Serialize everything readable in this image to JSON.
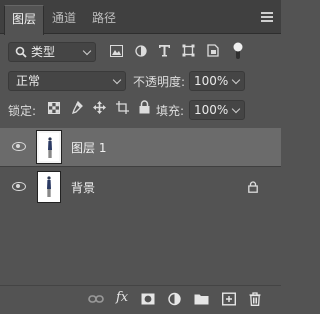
{
  "tabs": [
    {
      "label": "图层",
      "active": true
    },
    {
      "label": "通道",
      "active": false
    },
    {
      "label": "路径",
      "active": false
    }
  ],
  "filter": {
    "type_value": "类型",
    "icons": [
      "image-filter-icon",
      "adjustment-filter-icon",
      "type-filter-icon",
      "shape-filter-icon",
      "smart-object-filter-icon",
      "filter-toggle-icon"
    ]
  },
  "blend": {
    "mode_value": "正常",
    "opacity_label": "不透明度:",
    "opacity_value": "100%"
  },
  "lock": {
    "label": "锁定:",
    "icons": [
      "lock-transparent-pixels-icon",
      "lock-image-pixels-icon",
      "lock-position-icon",
      "lock-artboard-icon",
      "lock-all-icon"
    ],
    "fill_label": "填充:",
    "fill_value": "100%"
  },
  "layers": [
    {
      "name": "图层 1",
      "selected": true,
      "visible": true,
      "locked": false
    },
    {
      "name": "背景",
      "selected": false,
      "visible": true,
      "locked": true
    }
  ],
  "footer": {
    "icons": [
      "link-layers-icon",
      "layer-style-icon",
      "layer-mask-icon",
      "adjustment-layer-icon",
      "new-group-icon",
      "new-layer-icon",
      "delete-layer-icon"
    ],
    "fx_label": "fx"
  },
  "colors": {
    "panel_bg": "#535353",
    "selected_row": "#6b6b6b",
    "tab_bar": "#404040"
  }
}
